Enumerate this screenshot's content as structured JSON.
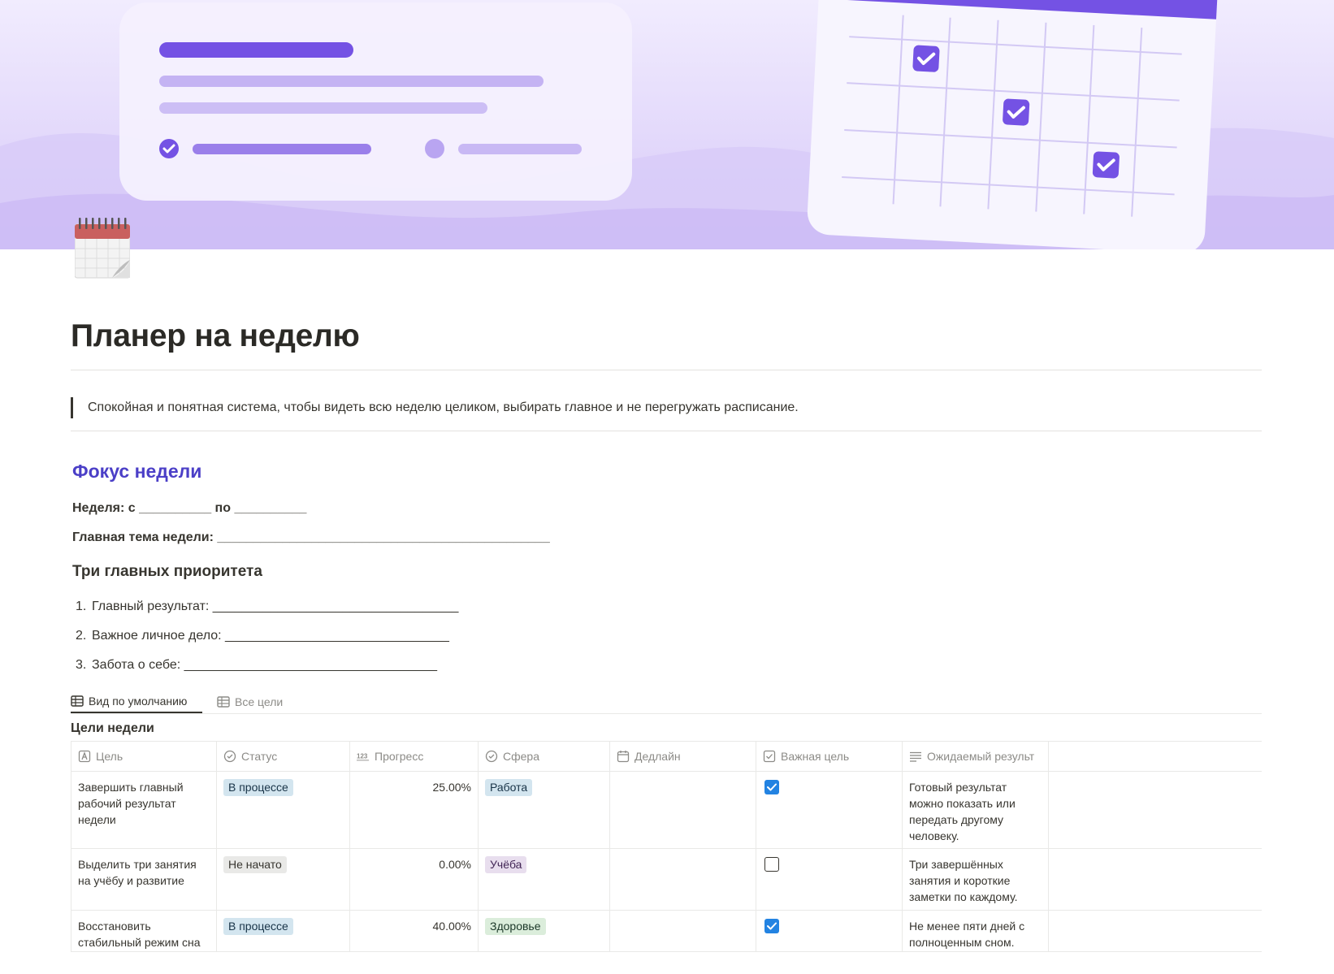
{
  "page": {
    "title": "Планер на неделю",
    "quote": "Спокойная и понятная система, чтобы видеть всю неделю целиком, выбирать главное и не перегружать расписание.",
    "icon": "calendar-icon"
  },
  "focus": {
    "heading": "Фокус недели",
    "week_line": "Неделя: с __________ по __________",
    "theme_line": "Главная тема недели: ______________________________________________",
    "priorities_heading": "Три главных приоритета",
    "priorities": [
      {
        "num": "1.",
        "text": "Главный результат: __________________________________"
      },
      {
        "num": "2.",
        "text": "Важное личное дело: _______________________________"
      },
      {
        "num": "3.",
        "text": "Забота о себе: ___________________________________"
      }
    ]
  },
  "views": {
    "tabs": [
      {
        "label": "Вид по умолчанию",
        "icon": "table-icon",
        "active": true
      },
      {
        "label": "Все цели",
        "icon": "table-icon",
        "active": false
      }
    ]
  },
  "database": {
    "title": "Цели недели",
    "columns": [
      {
        "label": "Цель",
        "icon": "text-property-icon"
      },
      {
        "label": "Статус",
        "icon": "status-property-icon"
      },
      {
        "label": "Прогресс",
        "icon": "number-property-icon"
      },
      {
        "label": "Сфера",
        "icon": "select-property-icon"
      },
      {
        "label": "Дедлайн",
        "icon": "date-property-icon"
      },
      {
        "label": "Важная цель",
        "icon": "checkbox-property-icon"
      },
      {
        "label": "Ожидаемый результ",
        "icon": "paragraph-property-icon"
      }
    ],
    "rows": [
      {
        "goal": "Завершить главный рабочий результат недели",
        "status": "В процессе",
        "progress": "25.00%",
        "area": "Работа",
        "deadline": "",
        "important": true,
        "result": "Готовый результат можно показать или передать другому человеку."
      },
      {
        "goal": "Выделить три занятия на учёбу и развитие",
        "status": "Не начато",
        "progress": "0.00%",
        "area": "Учёба",
        "deadline": "",
        "important": false,
        "result": "Три завершённых занятия и короткие заметки по каждому."
      },
      {
        "goal": "Восстановить стабильный режим сна",
        "status": "В процессе",
        "progress": "40.00%",
        "area": "Здоровье",
        "deadline": "",
        "important": true,
        "result": "Не менее пяти дней с полноценным сном."
      }
    ]
  },
  "colors": {
    "status_in_progress_bg": "#d3e5ef",
    "status_not_started_bg": "#e9e9e7",
    "area_work_bg": "#d3e5ef",
    "area_study_bg": "#e8deee",
    "area_health_bg": "#dbeddb",
    "accent_heading": "#4b3fc7",
    "checkbox_on": "#2383e2"
  }
}
